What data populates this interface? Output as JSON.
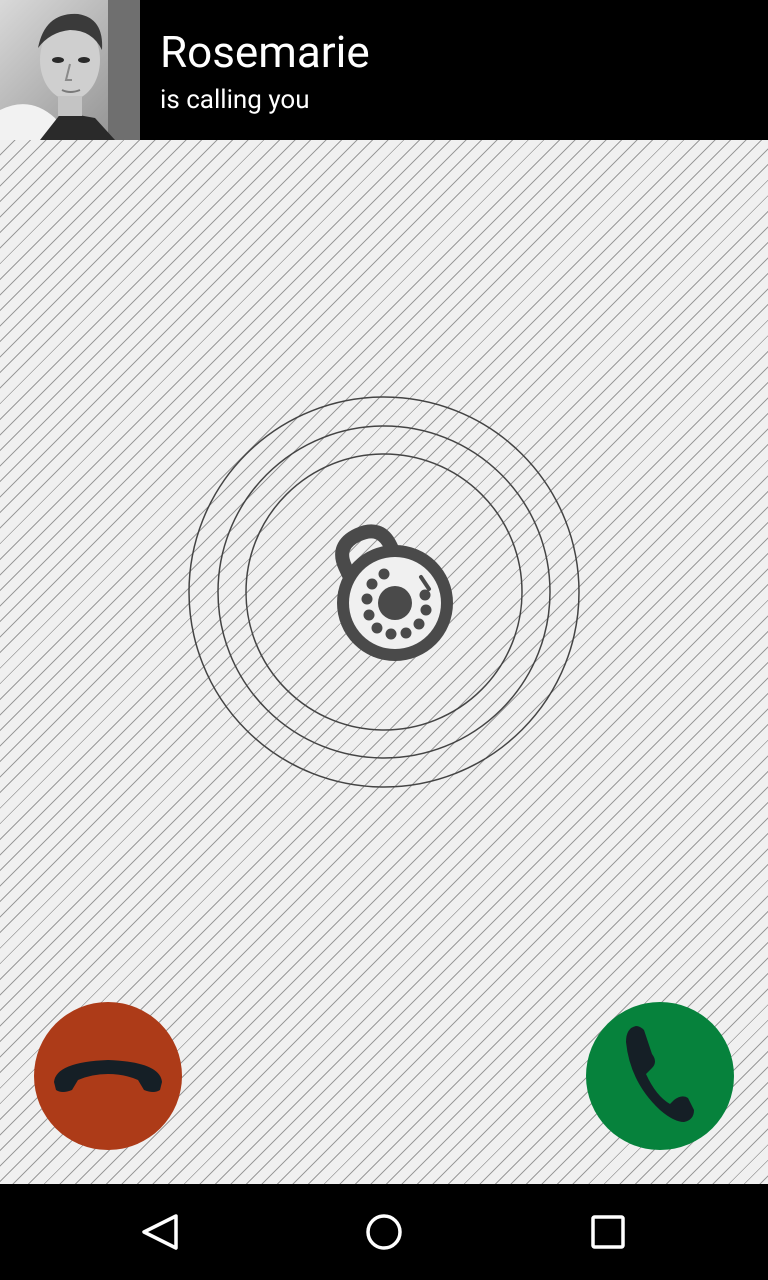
{
  "caller": {
    "name": "Rosemarie",
    "status": "is calling you",
    "photo_icon": "caller-photo"
  },
  "unlock": {
    "icon": "rotary-dial-lock-icon"
  },
  "actions": {
    "decline_icon": "hang-up-icon",
    "decline_color": "#ad3b18",
    "accept_icon": "phone-answer-icon",
    "accept_color": "#06823c"
  },
  "navbar": {
    "back_icon": "back-triangle-icon",
    "home_icon": "home-circle-icon",
    "recent_icon": "recent-apps-square-icon"
  }
}
